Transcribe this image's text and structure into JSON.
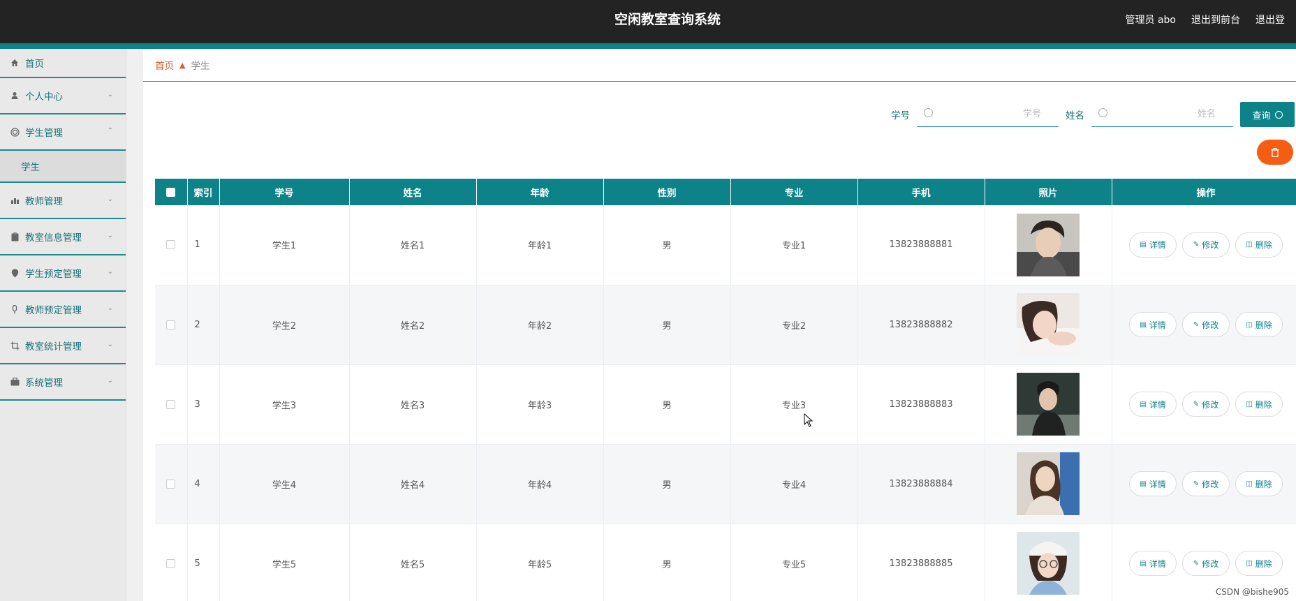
{
  "header": {
    "title": "空闲教室查询系统",
    "admin_label": "管理员 abo",
    "back_front_label": "退出到前台",
    "logout_label": "退出登"
  },
  "colors": {
    "accent": "#0e8289",
    "topbar": "#232323",
    "danger": "#f45d12",
    "breadcrumb_home": "#e4572e"
  },
  "sidebar": {
    "items": [
      {
        "label": "首页",
        "icon": "home-icon"
      },
      {
        "label": "个人中心",
        "icon": "user-icon"
      },
      {
        "label": "学生管理",
        "icon": "target-icon",
        "expanded": true,
        "children": [
          {
            "label": "学生"
          }
        ]
      },
      {
        "label": "教师管理",
        "icon": "chart-icon"
      },
      {
        "label": "教室信息管理",
        "icon": "clipboard-icon"
      },
      {
        "label": "学生预定管理",
        "icon": "pin-icon"
      },
      {
        "label": "教师预定管理",
        "icon": "microphone-icon"
      },
      {
        "label": "教室统计管理",
        "icon": "crop-icon"
      },
      {
        "label": "系统管理",
        "icon": "briefcase-icon"
      }
    ]
  },
  "breadcrumb": {
    "home": "首页",
    "current": "学生"
  },
  "search": {
    "student_id_label": "学号",
    "student_id_placeholder": "学号",
    "name_label": "姓名",
    "name_placeholder": "姓名",
    "query_label": "查询"
  },
  "table": {
    "headers": [
      "索引",
      "学号",
      "姓名",
      "年龄",
      "性别",
      "专业",
      "手机",
      "照片",
      "操作"
    ],
    "rows": [
      {
        "index": "1",
        "student_id": "学生1",
        "name": "姓名1",
        "age": "年龄1",
        "gender": "男",
        "major": "专业1",
        "phone": "13823888881"
      },
      {
        "index": "2",
        "student_id": "学生2",
        "name": "姓名2",
        "age": "年龄2",
        "gender": "男",
        "major": "专业2",
        "phone": "13823888882"
      },
      {
        "index": "3",
        "student_id": "学生3",
        "name": "姓名3",
        "age": "年龄3",
        "gender": "男",
        "major": "专业3",
        "phone": "13823888883"
      },
      {
        "index": "4",
        "student_id": "学生4",
        "name": "姓名4",
        "age": "年龄4",
        "gender": "男",
        "major": "专业4",
        "phone": "13823888884"
      },
      {
        "index": "5",
        "student_id": "学生5",
        "name": "姓名5",
        "age": "年龄5",
        "gender": "男",
        "major": "专业5",
        "phone": "13823888885"
      }
    ],
    "actions": {
      "detail": "详情",
      "edit": "修改",
      "delete": "删除"
    }
  },
  "watermark": "CSDN @bishe905"
}
